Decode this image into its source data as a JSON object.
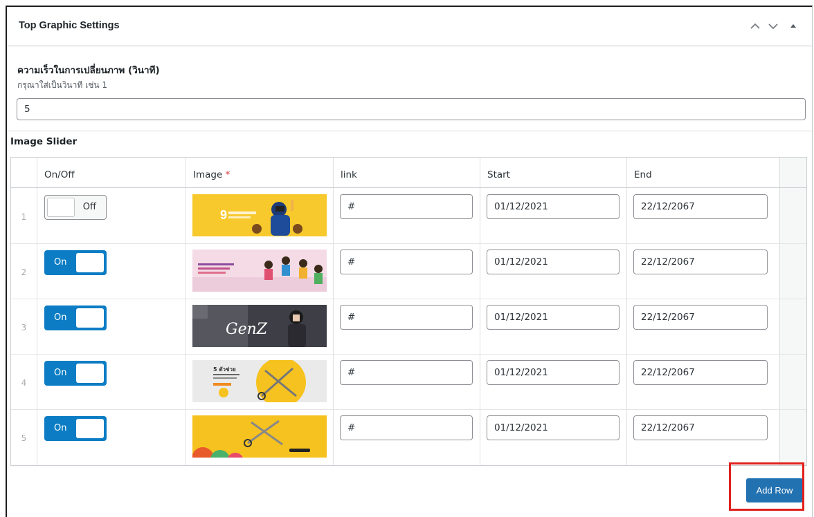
{
  "panel": {
    "title": "Top Graphic Settings",
    "controls": [
      "chevron-up-icon",
      "chevron-down-icon",
      "triangle-up-icon"
    ]
  },
  "speed_field": {
    "label": "ความเร็วในการเปลี่ยนภาพ (วินาที)",
    "help": "กรุณาใส่เป็นวินาที เช่น 1",
    "value": "5"
  },
  "slider": {
    "label": "Image Slider",
    "columns": {
      "onoff": "On/Off",
      "image": "Image",
      "image_required": "*",
      "link": "link",
      "start": "Start",
      "end": "End"
    },
    "rows": [
      {
        "num": "1",
        "toggle": "Off",
        "link": "#",
        "start": "01/12/2021",
        "end": "22/12/2067",
        "thumb_text": "9",
        "thumb_color": "#f7c325"
      },
      {
        "num": "2",
        "toggle": "On",
        "link": "#",
        "start": "01/12/2021",
        "end": "22/12/2067",
        "thumb_text": "",
        "thumb_color": "#f5dde6"
      },
      {
        "num": "3",
        "toggle": "On",
        "link": "#",
        "start": "01/12/2021",
        "end": "22/12/2067",
        "thumb_text": "GenZ",
        "thumb_color": "#4a4a52"
      },
      {
        "num": "4",
        "toggle": "On",
        "link": "#",
        "start": "01/12/2021",
        "end": "22/12/2067",
        "thumb_text": "5 ตัวช่วย",
        "thumb_color": "#ececec"
      },
      {
        "num": "5",
        "toggle": "On",
        "link": "#",
        "start": "01/12/2021",
        "end": "22/12/2067",
        "thumb_text": "",
        "thumb_color": "#f7c325"
      }
    ]
  },
  "add_row_label": "Add Row",
  "colors": {
    "toggle_on": "#0c7dc4",
    "button": "#2271b1",
    "highlight": "#e0201c"
  }
}
